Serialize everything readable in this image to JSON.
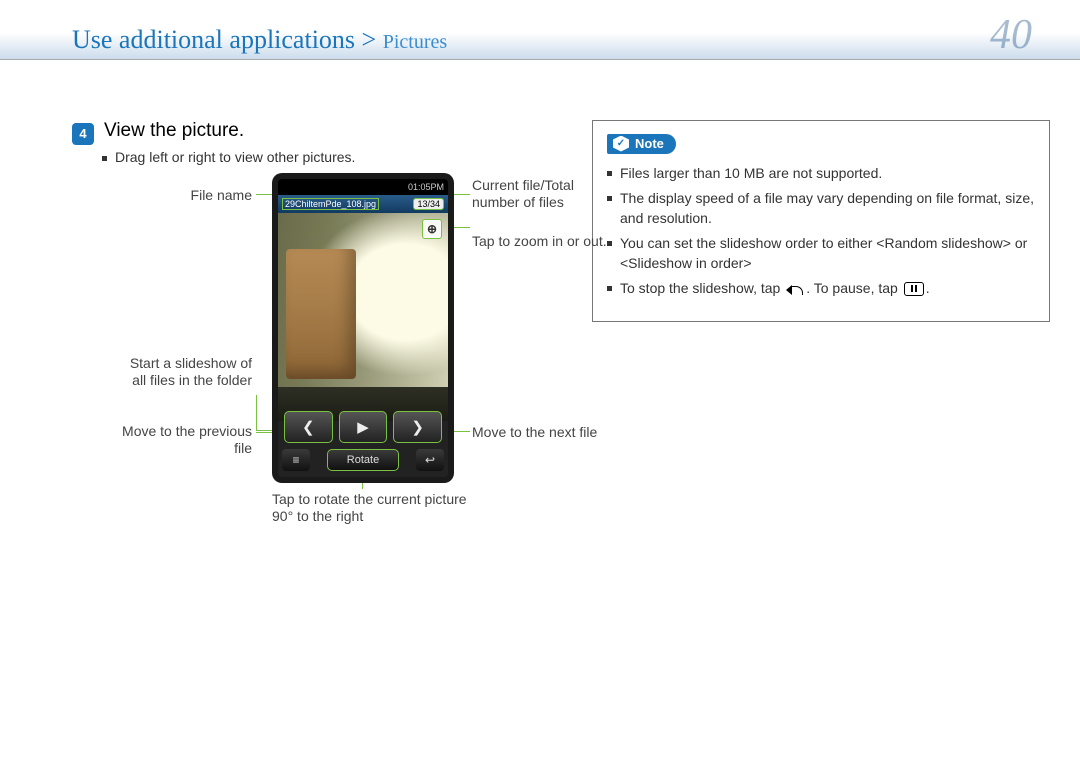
{
  "header": {
    "breadcrumb_main": "Use additional applications",
    "breadcrumb_sep": " > ",
    "breadcrumb_sub": "Pictures",
    "page_number": "40"
  },
  "step": {
    "number": "4",
    "title": "View the picture.",
    "bullet": "Drag left or right to view other pictures."
  },
  "labels": {
    "file_name": "File name",
    "current_total": "Current file/Total number of files",
    "zoom": "Tap to zoom in or out.",
    "slideshow": "Start a slideshow of all files in the folder",
    "prev": "Move to the previous file",
    "next": "Move to the next file",
    "rotate": "Tap to rotate the current picture 90° to the right"
  },
  "device": {
    "clock": "01:05PM",
    "filename": "29ChiltemPde_108.jpg",
    "counter": "13/34",
    "rotate_label": "Rotate",
    "zoom_glyph": "⊕",
    "prev_glyph": "❮",
    "play_glyph": "▶",
    "next_glyph": "❯",
    "menu_glyph": "≡",
    "back_glyph": "↩"
  },
  "note": {
    "badge": "Note",
    "cube_glyph": "✓",
    "items": [
      "Files larger than 10 MB are not supported.",
      "The display speed of a file may vary depending on file format, size, and resolution.",
      "You can set the slideshow order to either <Random slideshow> or <Slideshow in order>",
      "To stop the slideshow, tap "
    ],
    "item4_mid": ". To pause, tap ",
    "item4_end": "."
  }
}
